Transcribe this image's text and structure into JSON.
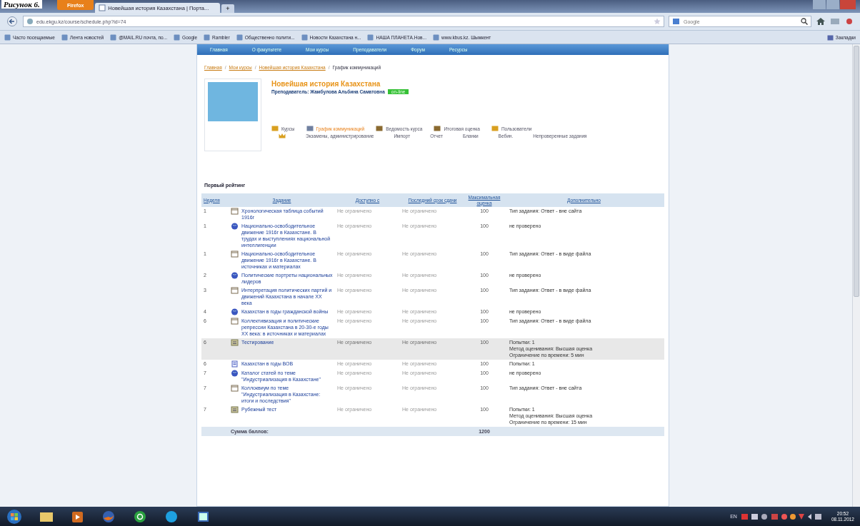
{
  "caption": "Рисунок 6.",
  "browser": {
    "menu_button": "Firefox",
    "tab_title": "Новейшая история Казахстана | Порта...",
    "new_tab": "+",
    "url": "edu.ekgu.kz/course/schedule.php?id=74",
    "search_engine": "Google",
    "bookmarks": [
      "Часто посещаемые",
      "Лента новостей",
      "@MAIL.RU почта, по...",
      "Google",
      "Rambler",
      "Общественно полити...",
      "Новости Казахстана н...",
      "НАША ПЛАНЕТА.Нов...",
      "www.kbus.kz. Шымкент"
    ],
    "bookmarks_menu": "Закладки"
  },
  "site_nav": [
    "Главная",
    "О факультете",
    "Мои курсы",
    "Преподаватели",
    "Форум",
    "Ресурсы"
  ],
  "breadcrumb_separator": "/",
  "breadcrumb": [
    {
      "label": "Главная",
      "link": true
    },
    {
      "label": "Мои курсы",
      "link": true
    },
    {
      "label": "Новейшая история Казахстана",
      "link": true
    },
    {
      "label": "График коммуникаций",
      "link": false
    }
  ],
  "course": {
    "title": "Новейшая история Казахстана",
    "teacher": "Преподаватель: Жамбулова Альбина Саматовна",
    "status": "on-line"
  },
  "course_links": [
    {
      "label": "Курсы",
      "selected": false
    },
    {
      "label": "График коммуникаций",
      "selected": true
    },
    {
      "label": "Ведомость курса",
      "selected": false
    },
    {
      "label": "Итоговая оценка",
      "selected": false
    },
    {
      "label": "Пользователи",
      "selected": false
    }
  ],
  "admin_links": [
    "Экзамены, администрирование",
    "Импорт",
    "Отчет",
    "Бланки",
    "Вебин.",
    "Непроверенные задания"
  ],
  "section_title": "Первый рейтинг",
  "table": {
    "columns": [
      "Неделя",
      "Задание",
      "Доступно с",
      "Последний срок сдачи",
      "Максимальная оценка",
      "Дополнительно"
    ],
    "rows": [
      {
        "week": "1",
        "kind": "assignment",
        "title": "Хронологическая таблица событий 1916г",
        "from": "Не ограничено",
        "due": "Не ограничено",
        "max": "100",
        "extra": [
          "Тип задания: Ответ - вне сайта"
        ],
        "highlighted": false
      },
      {
        "week": "1",
        "kind": "resource",
        "title": "Национально-освободительное движение 1916г в Казахстане. В трудах и выступлениях национальной интеллигенции",
        "from": "Не ограничено",
        "due": "Не ограничено",
        "max": "100",
        "extra": [
          "не проверено"
        ],
        "highlighted": false
      },
      {
        "week": "1",
        "kind": "assignment",
        "title": "Национально-освободительное движение 1916г в Казахстане. В источниках и материалах",
        "from": "Не ограничено",
        "due": "Не ограничено",
        "max": "100",
        "extra": [
          "Тип задания: Ответ - в виде файла"
        ],
        "highlighted": false
      },
      {
        "week": "2",
        "kind": "resource",
        "title": "Политические портреты национальных лидеров",
        "from": "Не ограничено",
        "due": "Не ограничено",
        "max": "100",
        "extra": [
          "не проверено"
        ],
        "highlighted": false
      },
      {
        "week": "3",
        "kind": "assignment",
        "title": "Интерпретация политических партий и движений Казахстана в начале ХХ века",
        "from": "Не ограничено",
        "due": "Не ограничено",
        "max": "100",
        "extra": [
          "Тип задания: Ответ - в виде файла"
        ],
        "highlighted": false
      },
      {
        "week": "4",
        "kind": "resource",
        "title": "Казахстан в годы гражданской войны",
        "from": "Не ограничено",
        "due": "Не ограничено",
        "max": "100",
        "extra": [
          "не проверено"
        ],
        "highlighted": false
      },
      {
        "week": "6",
        "kind": "assignment",
        "title": "Коллективизация и политические репрессии Казахстана в 20-30-е годы ХХ века: в источниках и материалах",
        "from": "Не ограничено",
        "due": "Не ограничено",
        "max": "100",
        "extra": [
          "Тип задания: Ответ - в виде файла"
        ],
        "highlighted": false
      },
      {
        "week": "6",
        "kind": "quiz",
        "title": "Тестирование",
        "from": "Не ограничено",
        "due": "Не ограничено",
        "max": "100",
        "extra": [
          "Попытки: 1",
          "Метод оценивания: Высшая оценка",
          "Ограничение по времени: 5 мин"
        ],
        "highlighted": true
      },
      {
        "week": "6",
        "kind": "lesson",
        "title": "Казахстан в годы ВОВ",
        "from": "Не ограничено",
        "due": "Не ограничено",
        "max": "100",
        "extra": [
          "Попытки: 1"
        ],
        "highlighted": false
      },
      {
        "week": "7",
        "kind": "resource",
        "title": "Каталог статей по теме \"Индустриализация в Казахстане\"",
        "from": "Не ограничено",
        "due": "Не ограничено",
        "max": "100",
        "extra": [
          "не проверено"
        ],
        "highlighted": false
      },
      {
        "week": "7",
        "kind": "assignment",
        "title": "Коллоквиум по теме \"Индустриализация в Казахстане: итоги и последствия\"",
        "from": "Не ограничено",
        "due": "Не ограничено",
        "max": "100",
        "extra": [
          "Тип задания: Ответ - вне сайта"
        ],
        "highlighted": false
      },
      {
        "week": "7",
        "kind": "quiz",
        "title": "Рубежный тест",
        "from": "Не ограничено",
        "due": "Не ограничено",
        "max": "100",
        "extra": [
          "Попытки: 1",
          "Метод оценивания: Высшая оценка",
          "Ограничение по времени: 15 мин"
        ],
        "highlighted": false
      }
    ],
    "total_label": "Сумма баллов:",
    "total": "1200"
  },
  "taskbar": {
    "language": "EN",
    "time": "20:52",
    "date": "08.11.2012"
  }
}
